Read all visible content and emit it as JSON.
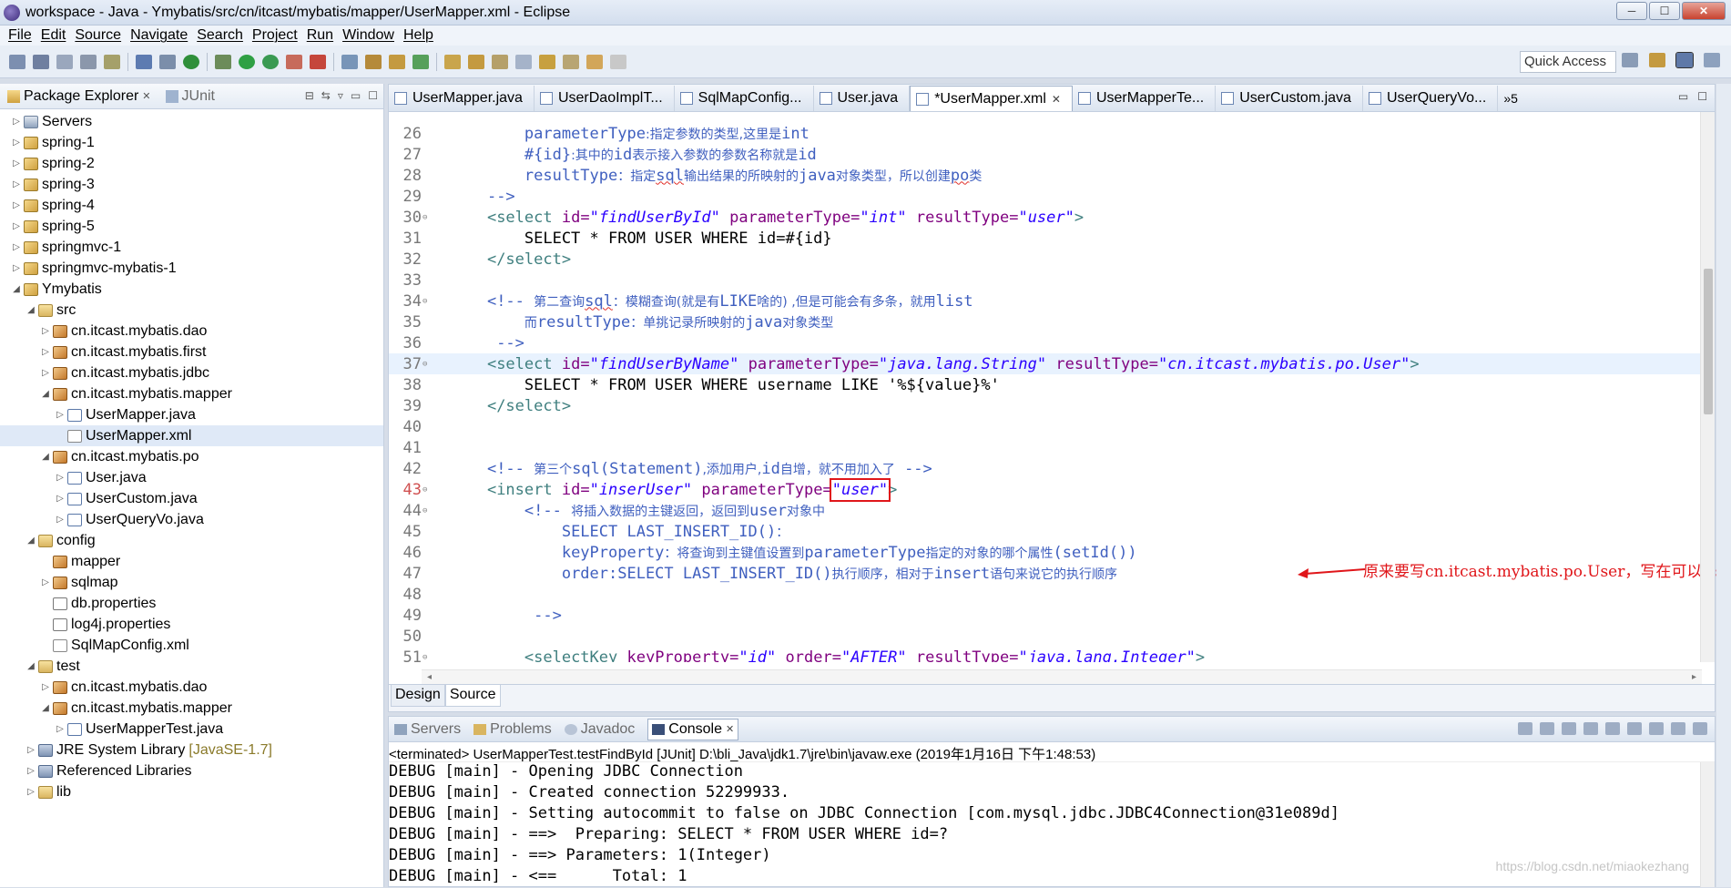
{
  "window": {
    "title": "workspace - Java - Ymybatis/src/cn/itcast/mybatis/mapper/UserMapper.xml - Eclipse",
    "controls": [
      "─",
      "☐",
      "✕"
    ]
  },
  "menu": [
    "File",
    "Edit",
    "Source",
    "Navigate",
    "Search",
    "Project",
    "Run",
    "Window",
    "Help"
  ],
  "quick_access": "Quick Access",
  "explorer": {
    "tabs": [
      {
        "label": "Package Explorer",
        "close": "✕"
      },
      {
        "label": "JUnit"
      }
    ],
    "tree": [
      {
        "arrow": "▷",
        "icon": "server",
        "label": "Servers",
        "indent": 0
      },
      {
        "arrow": "▷",
        "icon": "project",
        "label": "spring-1",
        "indent": 0
      },
      {
        "arrow": "▷",
        "icon": "project",
        "label": "spring-2",
        "indent": 0
      },
      {
        "arrow": "▷",
        "icon": "project",
        "label": "spring-3",
        "indent": 0
      },
      {
        "arrow": "▷",
        "icon": "project",
        "label": "spring-4",
        "indent": 0
      },
      {
        "arrow": "▷",
        "icon": "project",
        "label": "spring-5",
        "indent": 0
      },
      {
        "arrow": "▷",
        "icon": "project",
        "label": "springmvc-1",
        "indent": 0
      },
      {
        "arrow": "▷",
        "icon": "project",
        "label": "springmvc-mybatis-1",
        "indent": 0
      },
      {
        "arrow": "◢",
        "icon": "project",
        "label": "Ymybatis",
        "indent": 0
      },
      {
        "arrow": "◢",
        "icon": "folder",
        "label": "src",
        "indent": 1
      },
      {
        "arrow": "▷",
        "icon": "package",
        "label": "cn.itcast.mybatis.dao",
        "indent": 2
      },
      {
        "arrow": "▷",
        "icon": "package",
        "label": "cn.itcast.mybatis.first",
        "indent": 2
      },
      {
        "arrow": "▷",
        "icon": "package",
        "label": "cn.itcast.mybatis.jdbc",
        "indent": 2
      },
      {
        "arrow": "◢",
        "icon": "package",
        "label": "cn.itcast.mybatis.mapper",
        "indent": 2
      },
      {
        "arrow": "▷",
        "icon": "java",
        "label": "UserMapper.java",
        "indent": 3
      },
      {
        "arrow": "",
        "icon": "xml",
        "label": "UserMapper.xml",
        "indent": 3,
        "selected": true
      },
      {
        "arrow": "◢",
        "icon": "package",
        "label": "cn.itcast.mybatis.po",
        "indent": 2
      },
      {
        "arrow": "▷",
        "icon": "java",
        "label": "User.java",
        "indent": 3
      },
      {
        "arrow": "▷",
        "icon": "java",
        "label": "UserCustom.java",
        "indent": 3
      },
      {
        "arrow": "▷",
        "icon": "java",
        "label": "UserQueryVo.java",
        "indent": 3
      },
      {
        "arrow": "◢",
        "icon": "folder",
        "label": "config",
        "indent": 1
      },
      {
        "arrow": "",
        "icon": "package",
        "label": "mapper",
        "indent": 2
      },
      {
        "arrow": "▷",
        "icon": "package",
        "label": "sqlmap",
        "indent": 2
      },
      {
        "arrow": "",
        "icon": "props",
        "label": "db.properties",
        "indent": 2
      },
      {
        "arrow": "",
        "icon": "props",
        "label": "log4j.properties",
        "indent": 2
      },
      {
        "arrow": "",
        "icon": "xml",
        "label": "SqlMapConfig.xml",
        "indent": 2
      },
      {
        "arrow": "◢",
        "icon": "folder",
        "label": "test",
        "indent": 1
      },
      {
        "arrow": "▷",
        "icon": "package",
        "label": "cn.itcast.mybatis.dao",
        "indent": 2
      },
      {
        "arrow": "◢",
        "icon": "package",
        "label": "cn.itcast.mybatis.mapper",
        "indent": 2
      },
      {
        "arrow": "▷",
        "icon": "java",
        "label": "UserMapperTest.java",
        "indent": 3
      },
      {
        "arrow": "▷",
        "icon": "lib",
        "label": "JRE System Library",
        "suffix": "[JavaSE-1.7]",
        "indent": 1
      },
      {
        "arrow": "▷",
        "icon": "lib",
        "label": "Referenced Libraries",
        "indent": 1
      },
      {
        "arrow": "▷",
        "icon": "folder",
        "label": "lib",
        "indent": 1
      }
    ]
  },
  "editor": {
    "tabs": [
      {
        "label": "UserMapper.java"
      },
      {
        "label": "UserDaoImplT..."
      },
      {
        "label": "SqlMapConfig..."
      },
      {
        "label": "User.java"
      },
      {
        "label": "*UserMapper.xml",
        "active": true,
        "close": "✕"
      },
      {
        "label": "UserMapperTe..."
      },
      {
        "label": "UserCustom.java"
      },
      {
        "label": "UserQueryVo..."
      }
    ],
    "overflow": "»5",
    "bottom_tabs": [
      "Design",
      "Source"
    ],
    "annotation": "原来要写cn.itcast.mybatis.po.User，写在可以User也可user"
  },
  "console": {
    "tabs": [
      {
        "label": "Servers"
      },
      {
        "label": "Problems"
      },
      {
        "label": "Javadoc"
      },
      {
        "label": "Console",
        "active": true,
        "close": "✕"
      }
    ],
    "status": "<terminated> UserMapperTest.testFindById [JUnit] D:\\bli_Java\\jdk1.7\\jre\\bin\\javaw.exe (2019年1月16日 下午1:48:53)",
    "lines": [
      "DEBUG [main] - Opening JDBC Connection",
      "DEBUG [main] - Created connection 52299933.",
      "DEBUG [main] - Setting autocommit to false on JDBC Connection [com.mysql.jdbc.JDBC4Connection@31e089d]",
      "DEBUG [main] - ==>  Preparing: SELECT * FROM USER WHERE id=?",
      "DEBUG [main] - ==> Parameters: 1(Integer)",
      "DEBUG [main] - <==      Total: 1"
    ]
  },
  "watermark": "https://blog.csdn.net/miaokezhang"
}
